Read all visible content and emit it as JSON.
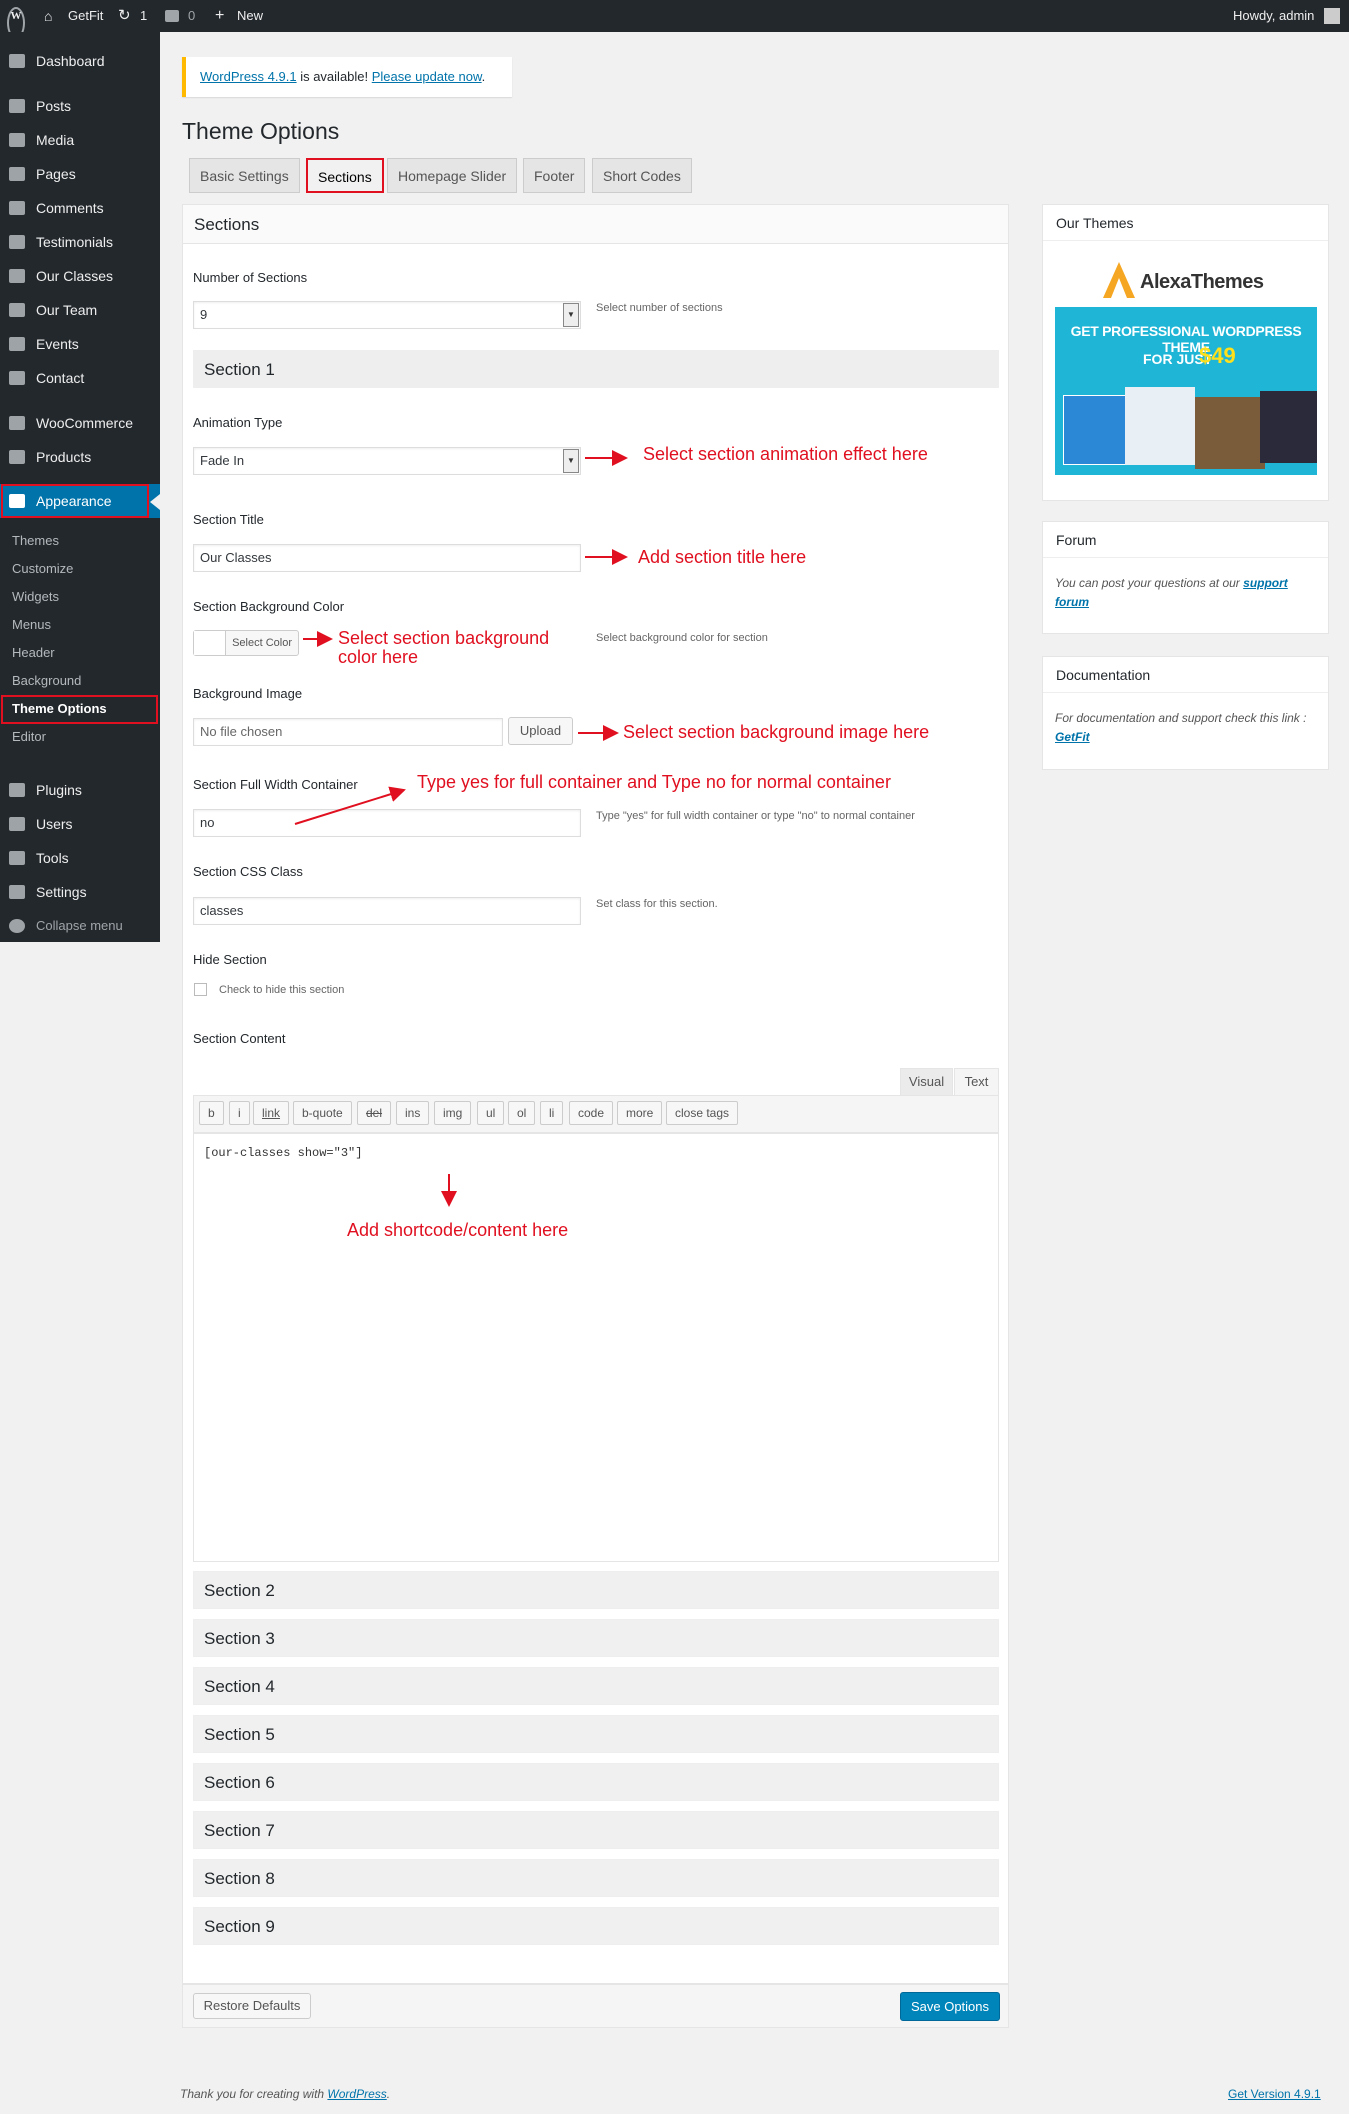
{
  "adminbar": {
    "site_name": "GetFit",
    "updates_count": "1",
    "comments_count": "0",
    "new_label": "New",
    "howdy": "Howdy, admin"
  },
  "sidebar": {
    "items": [
      {
        "label": "Dashboard",
        "icon": "dashboard-icon"
      },
      {
        "label": "Posts",
        "icon": "pin-icon"
      },
      {
        "label": "Media",
        "icon": "media-icon"
      },
      {
        "label": "Pages",
        "icon": "pages-icon"
      },
      {
        "label": "Comments",
        "icon": "comments-icon"
      },
      {
        "label": "Testimonials",
        "icon": "quote-icon"
      },
      {
        "label": "Our Classes",
        "icon": "pages-icon"
      },
      {
        "label": "Our Team",
        "icon": "team-icon"
      },
      {
        "label": "Events",
        "icon": "calendar-icon"
      },
      {
        "label": "Contact",
        "icon": "mail-icon"
      },
      {
        "label": "WooCommerce",
        "icon": "woo-icon"
      },
      {
        "label": "Products",
        "icon": "products-icon"
      },
      {
        "label": "Appearance",
        "icon": "brush-icon"
      },
      {
        "label": "Plugins",
        "icon": "plugin-icon"
      },
      {
        "label": "Users",
        "icon": "user-icon"
      },
      {
        "label": "Tools",
        "icon": "wrench-icon"
      },
      {
        "label": "Settings",
        "icon": "settings-icon"
      },
      {
        "label": "Collapse menu",
        "icon": "collapse-icon"
      }
    ],
    "appearance_sub": [
      "Themes",
      "Customize",
      "Widgets",
      "Menus",
      "Header",
      "Background",
      "Theme Options",
      "Editor"
    ]
  },
  "notice": {
    "version_link": "WordPress 4.9.1",
    "middle": " is available! ",
    "update_link": "Please update now",
    "end": "."
  },
  "page_title": "Theme Options",
  "tabs": [
    "Basic Settings",
    "Sections",
    "Homepage Slider",
    "Footer",
    "Short Codes"
  ],
  "main": {
    "heading": "Sections",
    "num_sections_label": "Number of Sections",
    "num_sections_value": "9",
    "num_sections_desc": "Select number of sections",
    "section1_title": "Section 1",
    "animation_label": "Animation Type",
    "animation_value": "Fade In",
    "section_title_label": "Section Title",
    "section_title_value": "Our Classes",
    "bg_color_label": "Section Background Color",
    "select_color": "Select Color",
    "bg_color_desc": "Select background color for section",
    "bg_image_label": "Background Image",
    "bg_image_value": "No file chosen",
    "upload": "Upload",
    "full_width_label": "Section Full Width Container",
    "full_width_value": "no",
    "full_width_desc": "Type \"yes\" for full width container or type \"no\" to normal container",
    "css_class_label": "Section CSS Class",
    "css_class_value": "classes",
    "css_class_desc": "Set class for this section.",
    "hide_label": "Hide Section",
    "hide_desc": "Check to hide this section",
    "content_label": "Section Content",
    "visual": "Visual",
    "text": "Text",
    "quicktags": [
      "b",
      "i",
      "link",
      "b-quote",
      "del",
      "ins",
      "img",
      "ul",
      "ol",
      "li",
      "code",
      "more",
      "close tags"
    ],
    "content_value": "[our-classes show=\"3\"]",
    "other_sections": [
      "Section 2",
      "Section 3",
      "Section 4",
      "Section 5",
      "Section 6",
      "Section 7",
      "Section 8",
      "Section 9"
    ],
    "restore": "Restore Defaults",
    "save": "Save Options"
  },
  "annotations": {
    "animation": "Select section animation effect here",
    "title": "Add section title here",
    "color_1": "Select section background",
    "color_2": "color here",
    "image": "Select section background image here",
    "full_width": "Type yes for full container and Type no for normal container",
    "content": "Add shortcode/content here"
  },
  "side": {
    "themes_title": "Our Themes",
    "brand": "AlexaThemes",
    "promo_1": "GET PROFESSIONAL WORDPRESS THEME",
    "promo_2": "FOR JUST",
    "promo_price": "$49",
    "forum_title": "Forum",
    "forum_text": "You can post your questions at our",
    "forum_link": "support forum",
    "doc_title": "Documentation",
    "doc_text": "For documentation and support check this link :",
    "doc_link": "GetFit"
  },
  "footer": {
    "thanks": "Thank you for creating with",
    "wp_link": "WordPress",
    "version": "Get Version 4.9.1"
  },
  "colors": {
    "accent": "#0073aa",
    "annotation": "#e01020",
    "adminbar": "#23282d",
    "notice": "#ffb900",
    "promo": "#1fb5d6",
    "price": "#ffe01a"
  }
}
